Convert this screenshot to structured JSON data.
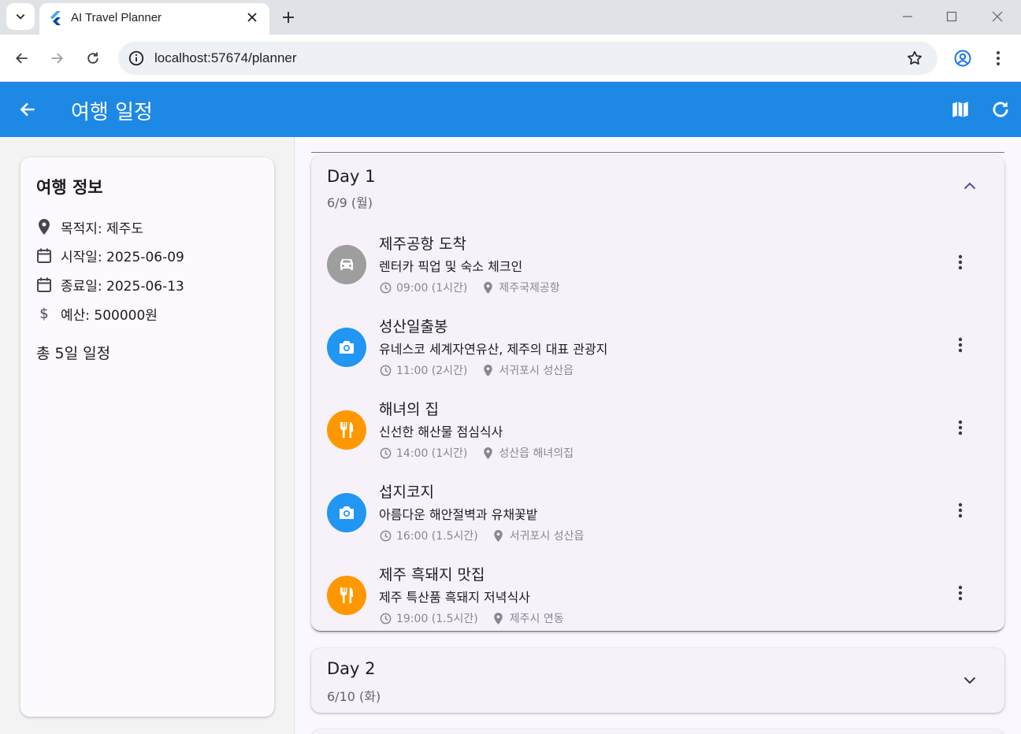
{
  "browser": {
    "tab_title": "AI Travel Planner",
    "url": "localhost:57674/planner"
  },
  "appbar": {
    "title": "여행 일정",
    "color": "#1e88e5"
  },
  "trip_info": {
    "title": "여행 정보",
    "destination": "목적지: 제주도",
    "start_date": "시작일: 2025-06-09",
    "end_date": "종료일: 2025-06-13",
    "budget": "예산: 500000원",
    "total_days": "총 5일 일정"
  },
  "days": [
    {
      "title": "Day 1",
      "date": "6/9 (월)",
      "expanded": true,
      "activities": [
        {
          "name": "제주공항 도착",
          "description": "렌터카 픽업 및 숙소 체크인",
          "time": "09:00 (1시간)",
          "location": "제주국제공항",
          "icon": "car-icon",
          "color": "#9e9e9e"
        },
        {
          "name": "성산일출봉",
          "description": "유네스코 세계자연유산, 제주의 대표 관광지",
          "time": "11:00 (2시간)",
          "location": "서귀포시 성산읍",
          "icon": "camera-icon",
          "color": "#2196f3"
        },
        {
          "name": "해녀의 집",
          "description": "신선한 해산물 점심식사",
          "time": "14:00 (1시간)",
          "location": "성산읍 해녀의집",
          "icon": "restaurant-icon",
          "color": "#ff9800"
        },
        {
          "name": "섭지코지",
          "description": "아름다운 해안절벽과 유채꽃밭",
          "time": "16:00 (1.5시간)",
          "location": "서귀포시 성산읍",
          "icon": "camera-icon",
          "color": "#2196f3"
        },
        {
          "name": "제주 흑돼지 맛집",
          "description": "제주 특산품 흑돼지 저녁식사",
          "time": "19:00 (1.5시간)",
          "location": "제주시 연동",
          "icon": "restaurant-icon",
          "color": "#ff9800"
        }
      ]
    },
    {
      "title": "Day 2",
      "date": "6/10 (화)",
      "expanded": false,
      "activities": []
    }
  ]
}
